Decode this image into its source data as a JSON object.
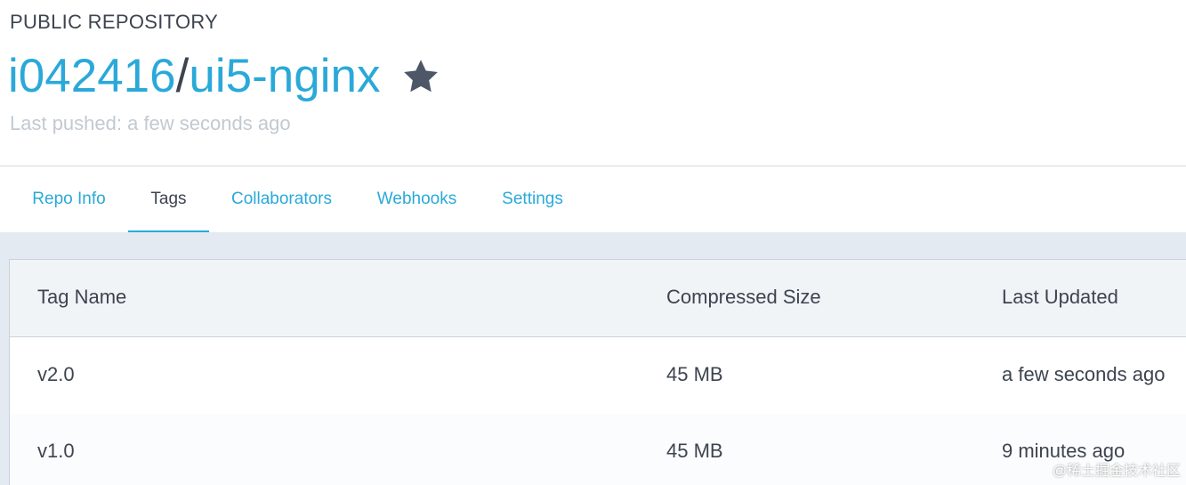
{
  "header": {
    "repo_kind": "PUBLIC REPOSITORY",
    "owner": "i042416",
    "separator": "/",
    "repo_name": "ui5-nginx",
    "star_icon": "star-icon",
    "last_pushed": "Last pushed: a few seconds ago"
  },
  "tabs": [
    {
      "label": "Repo Info",
      "active": false
    },
    {
      "label": "Tags",
      "active": true
    },
    {
      "label": "Collaborators",
      "active": false
    },
    {
      "label": "Webhooks",
      "active": false
    },
    {
      "label": "Settings",
      "active": false
    }
  ],
  "table": {
    "columns": [
      "Tag Name",
      "Compressed Size",
      "Last Updated"
    ],
    "rows": [
      {
        "tag": "v2.0",
        "size": "45 MB",
        "updated": "a few seconds ago"
      },
      {
        "tag": "v1.0",
        "size": "45 MB",
        "updated": "9 minutes ago"
      }
    ]
  },
  "colors": {
    "link": "#2aa9d9",
    "text": "#3d4450",
    "muted": "#c3c9d1",
    "star": "#4d5768",
    "content_bg": "#e4eaf1"
  },
  "watermark": "@稀土掘金技术社区"
}
